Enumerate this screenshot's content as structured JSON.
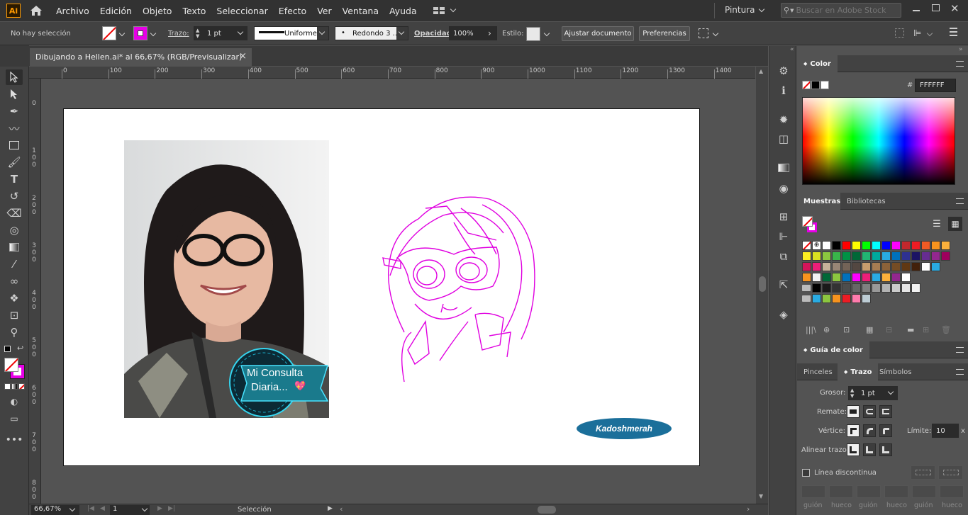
{
  "app": {
    "logo": "Ai",
    "workspace": "Pintura",
    "stock_search_placeholder": "Buscar en Adobe Stock"
  },
  "menu": [
    "Archivo",
    "Edición",
    "Objeto",
    "Texto",
    "Seleccionar",
    "Efecto",
    "Ver",
    "Ventana",
    "Ayuda"
  ],
  "control_bar": {
    "selection_status": "No hay selección",
    "stroke_label": "Trazo:",
    "stroke_weight": "1 pt",
    "stroke_profile": "Uniforme",
    "brush": "Redondo 3 ...",
    "opacity_label": "Opacidad:",
    "opacity_value": "100%",
    "style_label": "Estilo:",
    "fit_document_button": "Ajustar documento",
    "preferences_button": "Preferencias"
  },
  "document_tab": {
    "title": "Dibujando a Hellen.ai* al 66,67% (RGB/Previsualizar)",
    "close": "×"
  },
  "ruler": {
    "h_ticks": [
      "0",
      "100",
      "200",
      "300",
      "400",
      "500",
      "600",
      "700",
      "800",
      "900",
      "1000",
      "1100",
      "1200",
      "1300",
      "1400"
    ],
    "v_ticks": [
      "0",
      "100",
      "200",
      "300",
      "400",
      "500",
      "600",
      "700",
      "800"
    ]
  },
  "artboard": {
    "badge_line1": "Mi Consulta",
    "badge_line2": "Diaria...",
    "badge_heart": "💖",
    "signature": "Kadoshmerah"
  },
  "status_bar": {
    "zoom": "66,67%",
    "artboard_number": "1",
    "tool_status": "Selección"
  },
  "color_panel": {
    "title": "Color",
    "hex_label": "#",
    "hex_value": "FFFFFF"
  },
  "swatches_panel": {
    "tabs": [
      "Muestras",
      "Bibliotecas"
    ],
    "row1": [
      "#ffffff",
      "#000000",
      "#ff0000",
      "#ffff00",
      "#00ff00",
      "#00ffff",
      "#0000ff",
      "#ff00ff",
      "#c1272d",
      "#ed1c24",
      "#f15a24",
      "#f7931e",
      "#fbb03b"
    ],
    "row2": [
      "#fcee21",
      "#d9e021",
      "#8cc63f",
      "#39b54a",
      "#009245",
      "#006837",
      "#22b573",
      "#00a99d",
      "#29abe2",
      "#0071bc",
      "#2e3192",
      "#1b1464",
      "#662d91",
      "#93278f",
      "#9e005d"
    ],
    "row3": [
      "#d4145a",
      "#ed1e79",
      "#c7b299",
      "#998675",
      "#736357",
      "#534741",
      "#c69c6d",
      "#a67c52",
      "#8c6239",
      "#754c24",
      "#603813",
      "#42210b",
      "#ffffff",
      "#29abe2"
    ],
    "row4": [
      "#f7931e",
      "#f2f2f2",
      "#006837",
      "#8cc63f",
      "#0071bc",
      "#ff00ff",
      "#ed1e79",
      "#29abe2",
      "#fbb03b",
      "#93278f",
      "#ffffff"
    ],
    "row5": [
      "#000000",
      "#1a1a1a",
      "#333333",
      "#4d4d4d",
      "#666666",
      "#808080",
      "#999999",
      "#b3b3b3",
      "#cccccc",
      "#e6e6e6",
      "#f2f2f2"
    ],
    "row6": [
      "#29abe2",
      "#8cc63f",
      "#f7931e",
      "#ed1c24",
      "#ff7bac",
      "#bdccd4"
    ]
  },
  "guide_panel": {
    "title": "Guía de color"
  },
  "stroke_panel": {
    "tabs": [
      "Pinceles",
      "Trazo",
      "Símbolos"
    ],
    "weight_label": "Grosor:",
    "weight_value": "1 pt",
    "cap_label": "Remate:",
    "corner_label": "Vértice:",
    "limit_label": "Límite:",
    "limit_value": "10",
    "limit_unit": "x",
    "align_label": "Alinear trazo:",
    "dashed_label": "Línea discontinua",
    "dash_labels": [
      "guión",
      "hueco",
      "guión",
      "hueco",
      "guión",
      "hueco"
    ]
  }
}
